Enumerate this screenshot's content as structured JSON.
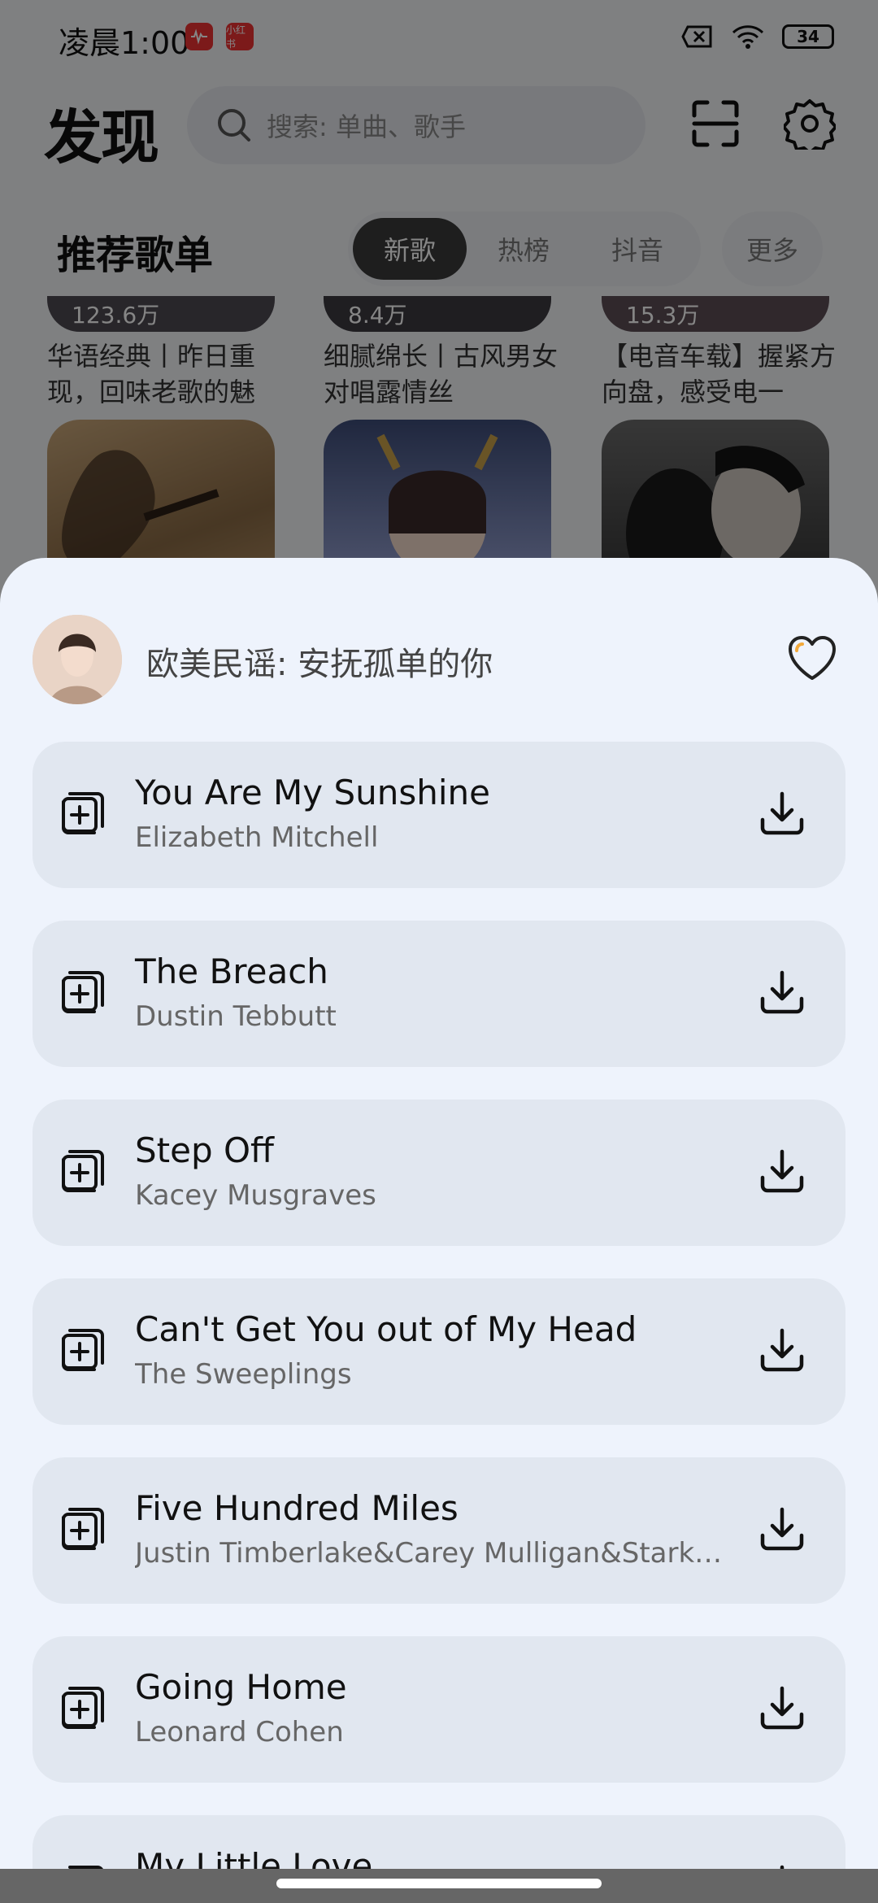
{
  "status_bar": {
    "time": "凌晨1:00",
    "badge1": "",
    "badge2": "小红书",
    "battery": "34"
  },
  "header": {
    "title": "发现",
    "search_placeholder": "搜索: 单曲、歌手"
  },
  "section": {
    "title": "推荐歌单",
    "tabs": [
      "新歌",
      "热榜",
      "抖音"
    ],
    "active_tab": "新歌",
    "more": "更多"
  },
  "playlists": [
    {
      "count": "123.6万",
      "name": "华语经典丨昨日重现，回味老歌的魅"
    },
    {
      "count": "8.4万",
      "name": "细腻绵长丨古风男女对唱露情丝"
    },
    {
      "count": "15.3万",
      "name": "【电音车载】握紧方向盘，感受电一"
    }
  ],
  "sheet": {
    "title": "欧美民谣: 安抚孤单的你",
    "songs": [
      {
        "title": "You Are My Sunshine",
        "artist": "Elizabeth Mitchell"
      },
      {
        "title": "The Breach",
        "artist": "Dustin Tebbutt"
      },
      {
        "title": "Step Off",
        "artist": "Kacey Musgraves"
      },
      {
        "title": "Can't Get You out of My Head",
        "artist": "The Sweeplings"
      },
      {
        "title": "Five Hundred Miles",
        "artist": "Justin Timberlake&Carey Mulligan&Stark S..."
      },
      {
        "title": "Going Home",
        "artist": "Leonard Cohen"
      },
      {
        "title": "My Little Love",
        "artist": ""
      }
    ]
  },
  "colors": {
    "sheet_bg": "#eef3fc",
    "row_bg": "#e1e7f0",
    "heart_accent": "#f2a93b"
  }
}
